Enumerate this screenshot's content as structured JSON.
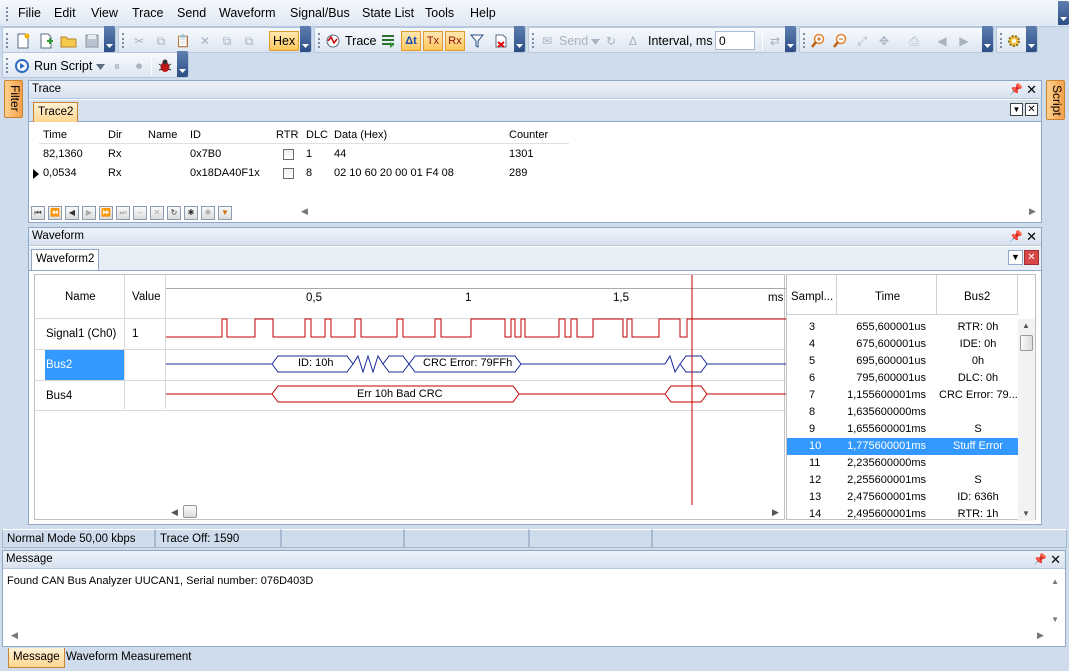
{
  "menu": [
    "Filie",
    "Edit",
    "View",
    "Trace",
    "Send",
    "Waveform",
    "Signal/Bus",
    "State List",
    "Tools",
    "Help"
  ],
  "toolbar": {
    "hex_label": "Hex",
    "trace_label": "Trace",
    "delta_t_label": "Δt",
    "tx_label": "Tx",
    "rx_label": "Rx",
    "send_label": "Send",
    "interval_label": "Interval, ms",
    "interval_value": "0",
    "run_script_label": "Run Script"
  },
  "side_tabs": {
    "left": "Filter",
    "right": "Script"
  },
  "trace_panel": {
    "title": "Trace",
    "tab": "Trace2",
    "columns": [
      "Time",
      "Dir",
      "Name",
      "ID",
      "RTR",
      "DLC",
      "Data (Hex)",
      "Counter"
    ],
    "rows": [
      {
        "time": "82,1360",
        "dir": "Rx",
        "name": "",
        "id": "0x7B0",
        "rtr": false,
        "dlc": "1",
        "data": "44",
        "counter": "1301"
      },
      {
        "time": "0,0534",
        "dir": "Rx",
        "name": "",
        "id": "0x18DA40F1x",
        "rtr": false,
        "dlc": "8",
        "data": "02 10 60 20 00 01 F4 08",
        "counter": "289"
      }
    ]
  },
  "waveform_panel": {
    "title": "Waveform",
    "tab": "Waveform2",
    "col_name": "Name",
    "col_value": "Value",
    "ruler_ticks": [
      "0,5",
      "1",
      "1,5",
      "ms"
    ],
    "signals": [
      {
        "name": "Signal1 (Ch0)",
        "value": "1"
      },
      {
        "name": "Bus2",
        "value": ""
      },
      {
        "name": "Bus4",
        "value": ""
      }
    ],
    "bus2_labels": [
      "ID: 10h",
      "CRC Error: 79FFh"
    ],
    "bus4_label": "Err 10h Bad CRC",
    "samples": {
      "columns": [
        "Sampl...",
        "Time",
        "Bus2"
      ],
      "rows": [
        {
          "n": "3",
          "time": "655,600001us",
          "bus": "RTR: 0h"
        },
        {
          "n": "4",
          "time": "675,600001us",
          "bus": "IDE: 0h"
        },
        {
          "n": "5",
          "time": "695,600001us",
          "bus": "0h"
        },
        {
          "n": "6",
          "time": "795,600001us",
          "bus": "DLC: 0h"
        },
        {
          "n": "7",
          "time": "1,155600001ms",
          "bus": "CRC Error: 79..."
        },
        {
          "n": "8",
          "time": "1,635600000ms",
          "bus": ""
        },
        {
          "n": "9",
          "time": "1,655600001ms",
          "bus": "S"
        },
        {
          "n": "10",
          "time": "1,775600001ms",
          "bus": "Stuff Error"
        },
        {
          "n": "11",
          "time": "2,235600000ms",
          "bus": ""
        },
        {
          "n": "12",
          "time": "2,255600001ms",
          "bus": "S"
        },
        {
          "n": "13",
          "time": "2,475600001ms",
          "bus": "ID: 636h"
        },
        {
          "n": "14",
          "time": "2,495600001ms",
          "bus": "RTR: 1h"
        }
      ],
      "selected_sample": "10"
    }
  },
  "status_bar": {
    "mode": "Normal Mode 50,00 kbps",
    "trace": "Trace Off: 1590"
  },
  "message_panel": {
    "title": "Message",
    "text": "Found CAN Bus Analyzer UUCAN1, Serial number: 076D403D",
    "tabs": [
      "Message",
      "Waveform Measurement"
    ]
  },
  "colors": {
    "selection": "#3399ff",
    "accent_orange": "#ffc85c",
    "cursor_line": "#c00000",
    "bus2_line": "#1a2a9a",
    "bus4_line": "#c00000",
    "signal_line": "#c00000"
  }
}
